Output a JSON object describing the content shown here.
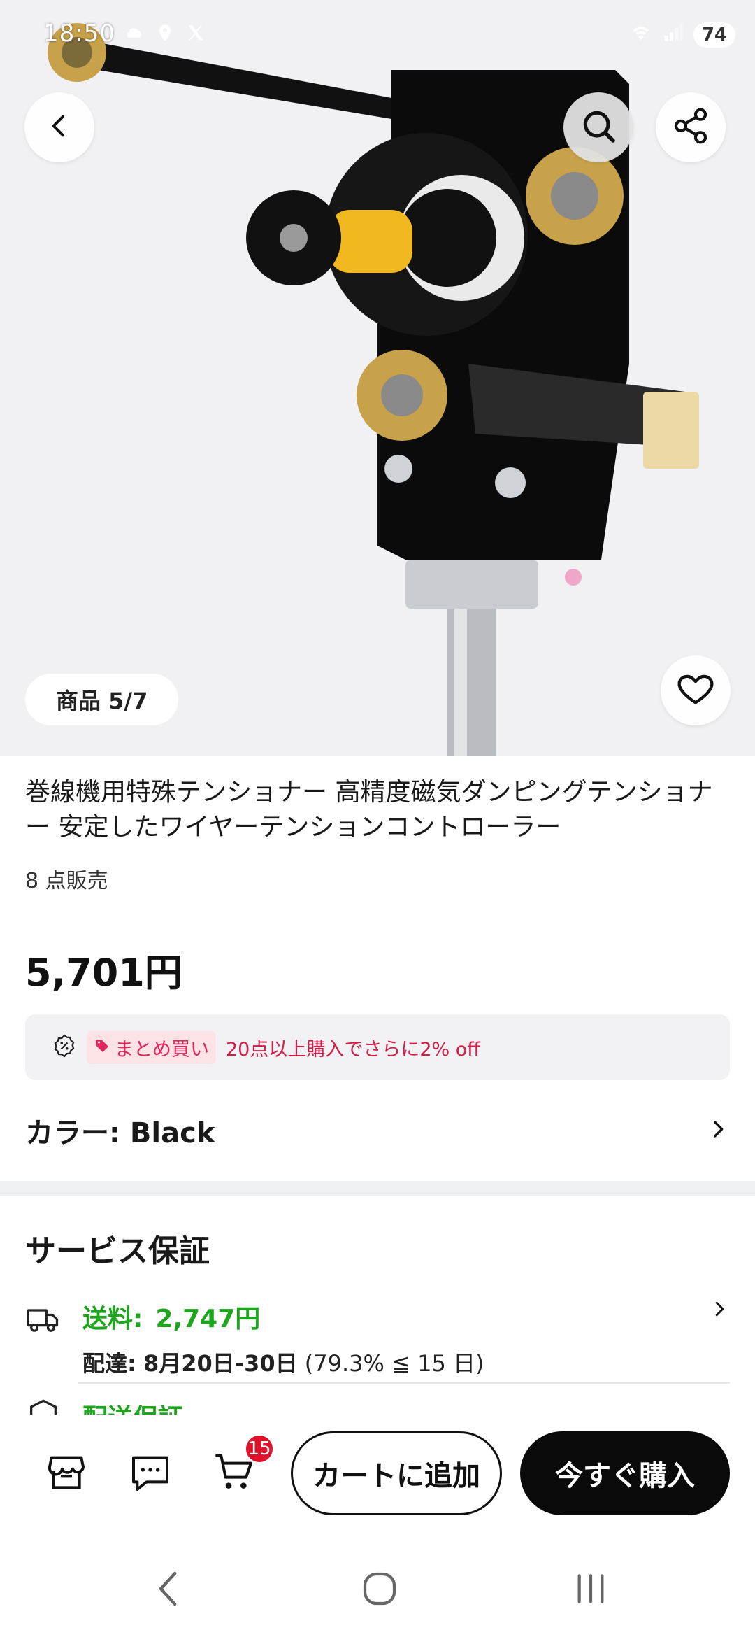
{
  "status_bar": {
    "time": "18:50",
    "battery": "74"
  },
  "gallery": {
    "counter": "商品 5/7"
  },
  "product": {
    "title": "巻線機用特殊テンショナー 高精度磁気ダンピングテンショナー 安定したワイヤーテンションコントローラー",
    "sold": "8 点販売",
    "price": "5,701円"
  },
  "promo": {
    "badge": "まとめ買い",
    "text": "20点以上購入でさらに2% off"
  },
  "color": {
    "label": "カラー: Black"
  },
  "service": {
    "title": "サービス保証",
    "shipping_label": "送料:",
    "shipping_fee": "2,747円",
    "delivery_label": "配達:",
    "delivery_dates": "8月20日-30日",
    "delivery_note": "(79.3% ≦ 15 日)",
    "guarantee": "配送保証"
  },
  "actions": {
    "cart_count": "15",
    "add_to_cart": "カートに追加",
    "buy_now": "今すぐ購入"
  },
  "icons": {
    "back": "chevron-left-icon",
    "search": "search-icon",
    "share": "share-icon",
    "favorite": "heart-icon",
    "store": "store-icon",
    "chat": "chat-icon",
    "cart": "cart-icon"
  },
  "colors": {
    "accent_green": "#1ea51e",
    "promo_red": "#d31d47",
    "badge_red": "#e0112b",
    "buy_black": "#0a0a0a"
  }
}
